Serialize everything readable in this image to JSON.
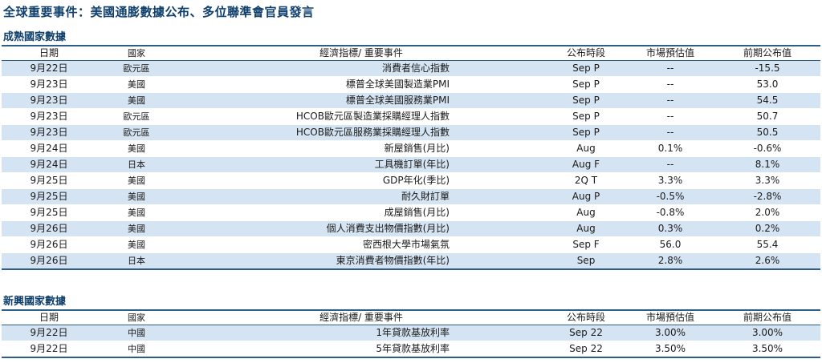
{
  "title": "全球重要事件：美國通膨數據公布、多位聯準會官員發言",
  "headers": {
    "date": "日期",
    "country": "國家",
    "event": "經濟指標/ 重要事件",
    "period": "公布時段",
    "estimate": "市場預估值",
    "previous": "前期公布值"
  },
  "developed": {
    "title": "成熟國家數據",
    "rows": [
      {
        "date": "9月22日",
        "country": "歐元區",
        "event": "消費者信心指數",
        "period": "Sep P",
        "estimate": "--",
        "previous": "-15.5"
      },
      {
        "date": "9月23日",
        "country": "美國",
        "event": "標普全球美國製造業PMI",
        "period": "Sep P",
        "estimate": "--",
        "previous": "53.0"
      },
      {
        "date": "9月23日",
        "country": "美國",
        "event": "標普全球美國服務業PMI",
        "period": "Sep P",
        "estimate": "--",
        "previous": "54.5"
      },
      {
        "date": "9月23日",
        "country": "歐元區",
        "event": "HCOB歐元區製造業採購經理人指數",
        "period": "Sep P",
        "estimate": "--",
        "previous": "50.7"
      },
      {
        "date": "9月23日",
        "country": "歐元區",
        "event": "HCOB歐元區服務業採購經理人指數",
        "period": "Sep P",
        "estimate": "--",
        "previous": "50.5"
      },
      {
        "date": "9月24日",
        "country": "美國",
        "event": "新屋銷售(月比)",
        "period": "Aug",
        "estimate": "0.1%",
        "previous": "-0.6%"
      },
      {
        "date": "9月24日",
        "country": "日本",
        "event": "工具機訂單(年比)",
        "period": "Aug F",
        "estimate": "--",
        "previous": "8.1%"
      },
      {
        "date": "9月25日",
        "country": "美國",
        "event": "GDP年化(季比)",
        "period": "2Q T",
        "estimate": "3.3%",
        "previous": "3.3%"
      },
      {
        "date": "9月25日",
        "country": "美國",
        "event": "耐久財訂單",
        "period": "Aug P",
        "estimate": "-0.5%",
        "previous": "-2.8%"
      },
      {
        "date": "9月25日",
        "country": "美國",
        "event": "成屋銷售(月比)",
        "period": "Aug",
        "estimate": "-0.8%",
        "previous": "2.0%"
      },
      {
        "date": "9月26日",
        "country": "美國",
        "event": "個人消費支出物價指數(月比)",
        "period": "Aug",
        "estimate": "0.3%",
        "previous": "0.2%"
      },
      {
        "date": "9月26日",
        "country": "美國",
        "event": "密西根大學市場氣氛",
        "period": "Sep F",
        "estimate": "56.0",
        "previous": "55.4"
      },
      {
        "date": "9月26日",
        "country": "日本",
        "event": "東京消費者物價指數(年比)",
        "period": "Sep",
        "estimate": "2.8%",
        "previous": "2.6%"
      }
    ]
  },
  "emerging": {
    "title": "新興國家數據",
    "rows": [
      {
        "date": "9月22日",
        "country": "中國",
        "event": "1年貸款基放利率",
        "period": "Sep 22",
        "estimate": "3.00%",
        "previous": "3.00%"
      },
      {
        "date": "9月22日",
        "country": "中國",
        "event": "5年貸款基放利率",
        "period": "Sep 22",
        "estimate": "3.50%",
        "previous": "3.50%"
      }
    ]
  },
  "colors": {
    "accent": "#0f3f6b",
    "rule": "#2f5d8a",
    "stripe": "#d5e4f2"
  }
}
